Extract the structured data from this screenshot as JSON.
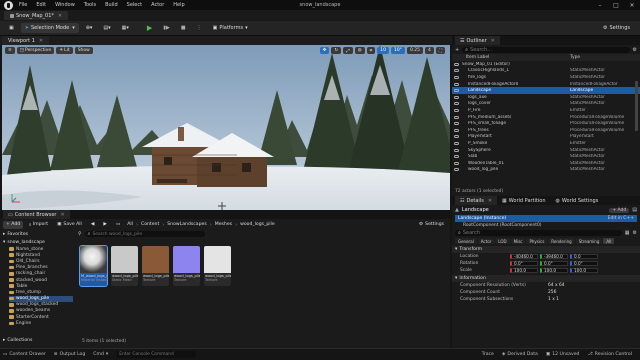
{
  "app": {
    "title": "snow_landscape",
    "menu": [
      "File",
      "Edit",
      "Window",
      "Tools",
      "Build",
      "Select",
      "Actor",
      "Help"
    ],
    "level_tab": "Snow_Map_01*"
  },
  "toolbar": {
    "save_icon": "save-icon",
    "mode_label": "Selection Mode",
    "platforms_label": "Platforms",
    "settings_label": "Settings"
  },
  "viewport": {
    "tab_label": "Viewport 1",
    "perspective_label": "Perspective",
    "lit_label": "Lit",
    "show_label": "Show",
    "snap_values": [
      "10",
      "10°",
      "0.25",
      "4"
    ]
  },
  "outliner": {
    "tab_label": "Outliner",
    "search_placeholder": "Search...",
    "col_item": "Item Label",
    "col_type": "Type",
    "items": [
      {
        "label": "Snow_Map_01 (Editor)",
        "type": "",
        "indent": 0,
        "selected": false
      },
      {
        "label": "ClassicHighlands_1",
        "type": "StaticMeshActor",
        "indent": 1,
        "selected": false
      },
      {
        "label": "fire_logs",
        "type": "StaticMeshActor",
        "indent": 1,
        "selected": false
      },
      {
        "label": "InstancedFoliageActor0",
        "type": "InstancedFoliageActor",
        "indent": 1,
        "selected": false
      },
      {
        "label": "Landscape",
        "type": "Landscape",
        "indent": 1,
        "selected": true
      },
      {
        "label": "logs_axe",
        "type": "StaticMeshActor",
        "indent": 1,
        "selected": false
      },
      {
        "label": "logs_cover",
        "type": "StaticMeshActor",
        "indent": 1,
        "selected": false
      },
      {
        "label": "P_Fire",
        "type": "Emitter",
        "indent": 1,
        "selected": false
      },
      {
        "label": "PFS_medium_assets",
        "type": "ProceduralFoliageVolume",
        "indent": 1,
        "selected": false
      },
      {
        "label": "PFS_small_foliage",
        "type": "ProceduralFoliageVolume",
        "indent": 1,
        "selected": false
      },
      {
        "label": "PFS_trees",
        "type": "ProceduralFoliageVolume",
        "indent": 1,
        "selected": false
      },
      {
        "label": "PlayerStart",
        "type": "PlayerStart",
        "indent": 1,
        "selected": false
      },
      {
        "label": "P_Smoke",
        "type": "Emitter",
        "indent": 1,
        "selected": false
      },
      {
        "label": "SkySphere",
        "type": "StaticMeshActor",
        "indent": 1,
        "selected": false
      },
      {
        "label": "Slab",
        "type": "StaticMeshActor",
        "indent": 1,
        "selected": false
      },
      {
        "label": "WoodenTable_01",
        "type": "StaticMeshActor",
        "indent": 1,
        "selected": false
      },
      {
        "label": "wood_log_pile",
        "type": "StaticMeshActor",
        "indent": 1,
        "selected": false
      }
    ],
    "footer": "72 actors (1 selected)"
  },
  "details": {
    "tab_label": "Details",
    "world_partition_label": "World Partition",
    "world_settings_label": "World Settings",
    "actor_name": "Landscape",
    "add_label": "+ Add",
    "instance_label": "Landscape (Instance)",
    "edit_in_label": "Edit in C++",
    "root_component": "RootComponent (RootComponent0)",
    "search_placeholder": "Search",
    "filter_tabs": [
      "General",
      "Actor",
      "LOD",
      "Misc",
      "Physics",
      "Rendering",
      "Streaming",
      "All"
    ],
    "active_filter": "All",
    "transform_label": "Transform",
    "location_label": "Location",
    "rotation_label": "Rotation",
    "scale_label": "Scale",
    "location_values": [
      "-40460.0",
      "-39460.0",
      "0.0"
    ],
    "rotation_values": [
      "0.0°",
      "0.0°",
      "0.0°"
    ],
    "scale_values": [
      "100.0",
      "100.0",
      "100.0"
    ],
    "information_label": "Information",
    "info_rows": [
      {
        "key": "Component Resolution (Verts)",
        "value": "64 x 64"
      },
      {
        "key": "Component Count",
        "value": "256"
      },
      {
        "key": "Component Subsections",
        "value": "1 x 1"
      }
    ]
  },
  "content_browser": {
    "tab_label": "Content Browser",
    "add_label": "+ Add",
    "import_label": "Import",
    "save_all_label": "Save All",
    "settings_label": "Settings",
    "breadcrumb": [
      "All",
      "Content",
      "SnowLandscapes",
      "Meshes",
      "wood_logs_pile"
    ],
    "favorites_label": "Favorites",
    "project_label": "snow_landscape",
    "search_placeholder": "Search wood_logs_pile",
    "folders": [
      {
        "label": "Name_stone",
        "selected": false
      },
      {
        "label": "Nightstand",
        "selected": false
      },
      {
        "label": "Old_Chairs",
        "selected": false
      },
      {
        "label": "Pine_branches",
        "selected": false
      },
      {
        "label": "rocking_chair",
        "selected": false
      },
      {
        "label": "stacked_wood",
        "selected": false
      },
      {
        "label": "Table",
        "selected": false
      },
      {
        "label": "tree_stump",
        "selected": false
      },
      {
        "label": "wood_logs_pile",
        "selected": true
      },
      {
        "label": "wood_logs_stacked",
        "selected": false
      },
      {
        "label": "wooden_beams",
        "selected": false
      },
      {
        "label": "StarterContent",
        "selected": false
      },
      {
        "label": "Engine",
        "selected": false
      }
    ],
    "assets": [
      {
        "name": "M_wood_logs_pile",
        "type": "Material Instance",
        "color": "#d9d9d9",
        "selected": true
      },
      {
        "name": "wood_logs_pile",
        "type": "Static Mesh",
        "color": "#c9c9c9",
        "selected": false
      },
      {
        "name": "wood_logs_pile_BaseColor",
        "type": "Texture",
        "color": "#8a5a36",
        "selected": false
      },
      {
        "name": "wood_logs_pile_Normal",
        "type": "Texture",
        "color": "#8d84f0",
        "selected": false
      },
      {
        "name": "wood_logs_pile_ORM",
        "type": "Texture",
        "color": "#e4e4e4",
        "selected": false
      }
    ],
    "status": "5 items (1 selected)",
    "collections_label": "Collections"
  },
  "statusbar": {
    "content_drawer": "Content Drawer",
    "output_log": "Output Log",
    "cmd_label": "Cmd",
    "console_placeholder": "Enter Console Command",
    "trace_label": "Trace",
    "derived_data_label": "Derived Data",
    "unsaved_label": "12 Unsaved",
    "revision_label": "Revision Control"
  },
  "colors": {
    "accent": "#1e5aa8",
    "play_green": "#4fc04f",
    "folder": "#c9a15a"
  }
}
